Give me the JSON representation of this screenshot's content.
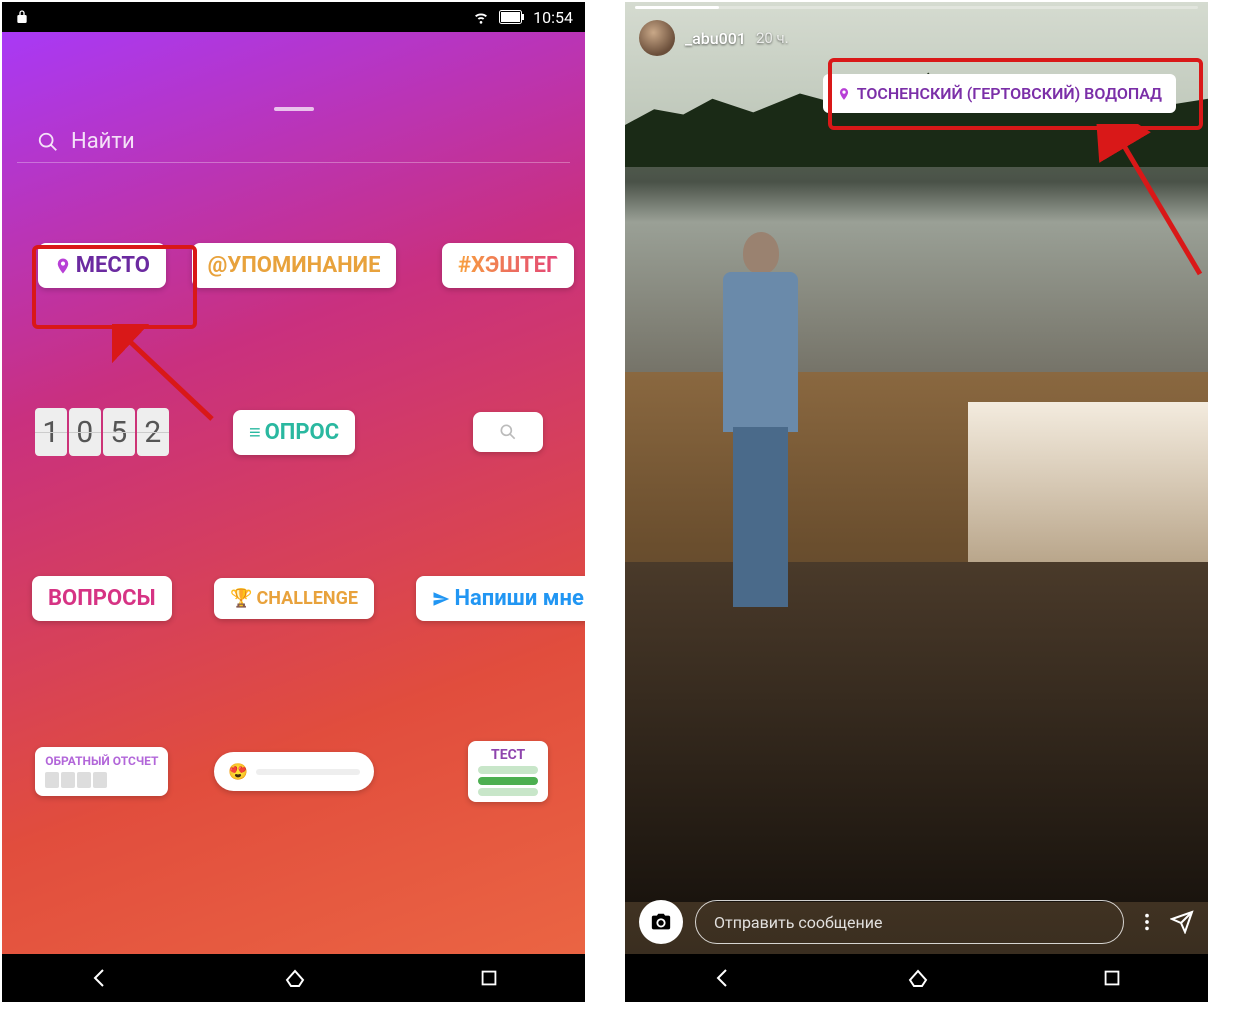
{
  "left": {
    "status": {
      "time": "10:54"
    },
    "search": {
      "placeholder": "Найти"
    },
    "stickers": {
      "location": "МЕСТО",
      "mention": "@УПОМИНАНИЕ",
      "hashtag": "#ХЭШТЕГ",
      "clock_digits": [
        "1",
        "0",
        "5",
        "2"
      ],
      "poll": "ОПРОС",
      "questions": "ВОПРОСЫ",
      "challenge": "CHALLENGE",
      "dm": "Напиши мне",
      "countdown": "ОБРАТНЫЙ ОТСЧЕТ",
      "test": "ТЕСТ"
    }
  },
  "right": {
    "username": "_abu001",
    "timestamp": "20 ч.",
    "location_tag": "ТОСНЕНСКИЙ (ГЕРТОВСКИЙ) ВОДОПАД",
    "reply_placeholder": "Отправить сообщение"
  }
}
